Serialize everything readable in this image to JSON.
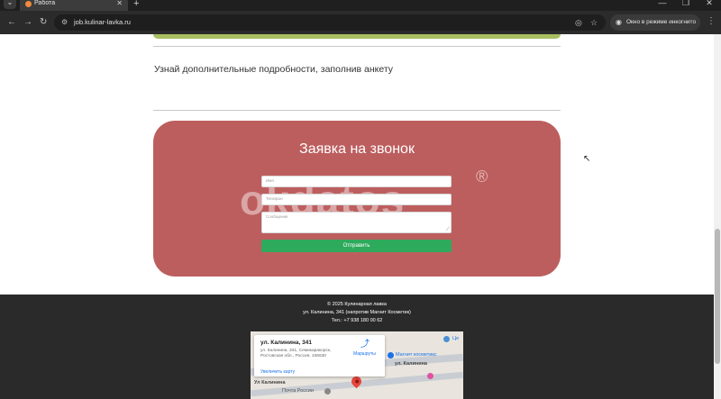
{
  "browser": {
    "tab_title": "Работа",
    "url": "job.kulinar-lavka.ru",
    "incognito_label": "Окно в режиме инкогнито",
    "new_tab": "+",
    "tab_close": "✕"
  },
  "page": {
    "subtitle": "Узнай дополнительные подробности, заполнив анкету",
    "form": {
      "title": "Заявка на звонок",
      "watermark": "okdatos",
      "watermark_mark": "®",
      "name_placeholder": "Имя",
      "phone_placeholder": "Телефон",
      "message_placeholder": "Сообщение",
      "submit_label": "Отправить"
    },
    "footer": {
      "copyright": "© 2025 Кулинарная лавка",
      "address": "ул. Калинина, 341 (напротив Магнит Косметик)",
      "phone": "Тел.: +7 938 180 00 62"
    },
    "map": {
      "place_name": "ул. Калинина, 341",
      "place_address": "ул. Калинина, 341, Семикаракорск, Ростовская обл., Россия, 346630",
      "enlarge_link": "Увеличить карту",
      "routes_label": "Маршруты",
      "road_1": "ул. Калинина",
      "road_2": "Ул Калинина",
      "poi_1": "Магнит косметикс",
      "poi_2": "Почта России",
      "poi_3": "Це"
    }
  },
  "colors": {
    "callback_bg": "#bd5e5e",
    "submit_bg": "#2eaa5c",
    "footer_bg": "#2a2a2a",
    "accent_strip": "#a8c060"
  }
}
